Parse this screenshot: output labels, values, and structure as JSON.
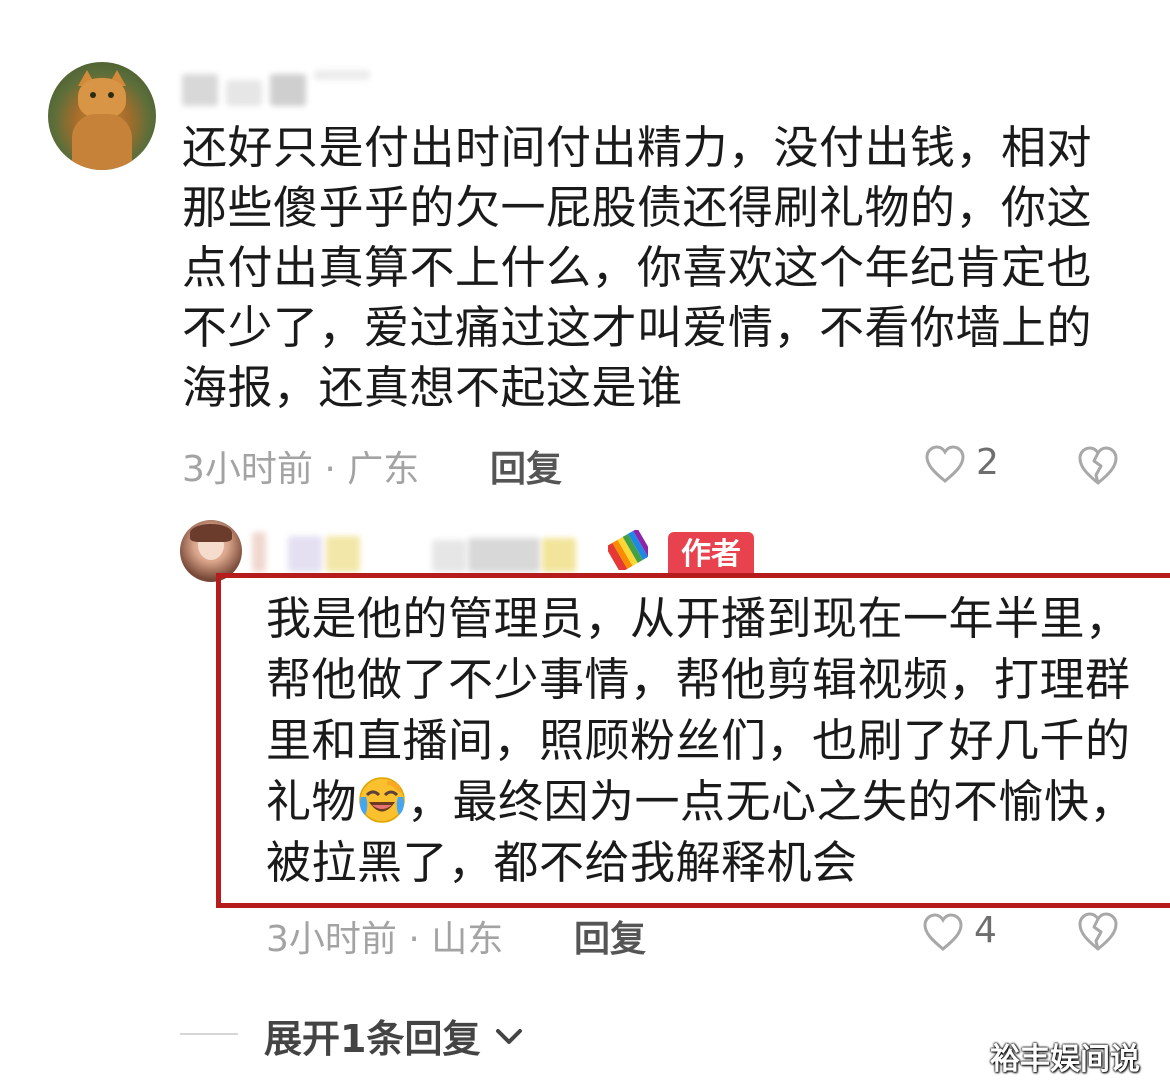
{
  "comments": [
    {
      "text": "还好只是付出时间付出精力，没付出钱，相对那些傻乎乎的欠一屁股债还得刷礼物的，你这点付出真算不上什么，你喜欢这个年纪肯定也不少了，爱过痛过这才叫爱情，不看你墙上的海报，还真想不起这是谁",
      "time": "3小时前",
      "location": "广东",
      "separator": "·",
      "reply_label": "回复",
      "likes": "2",
      "avatar_icon": "cat-avatar"
    },
    {
      "badge": "作者",
      "text_before_emoji": "我是他的管理员，从开播到现在一年半里，帮他做了不少事情，帮他剪辑视频，打理群里和直播间，照顾粉丝们，也刷了好几千的礼物",
      "text_after_emoji": "，最终因为一点无心之失的不愉快，被拉黑了，都不给我解释机会",
      "time": "3小时前",
      "location": "山东",
      "separator": "·",
      "reply_label": "回复",
      "likes": "4",
      "avatar_icon": "girl-avatar",
      "highlight_color": "#b71c1c"
    }
  ],
  "expand_label": "展开1条回复",
  "watermark": "裕丰娱间说",
  "colors": {
    "badge_bg": "#e8424f",
    "meta_text": "#a3a3a3"
  }
}
